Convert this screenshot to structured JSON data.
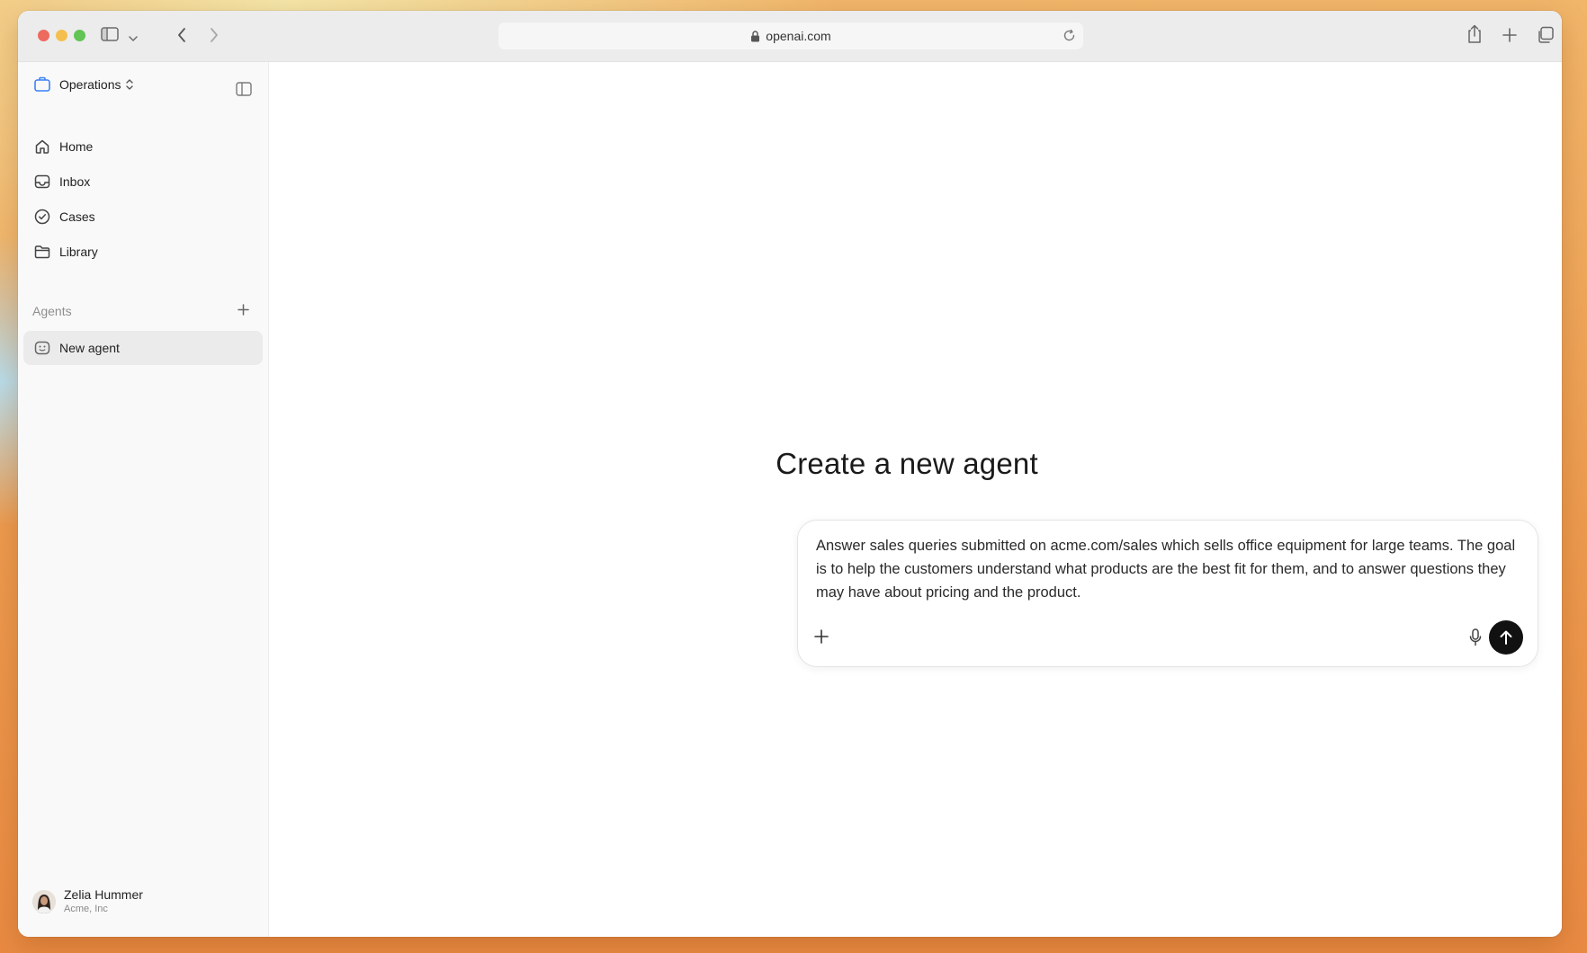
{
  "browser": {
    "url": "openai.com"
  },
  "sidebar": {
    "workspace": "Operations",
    "nav": [
      {
        "label": "Home"
      },
      {
        "label": "Inbox"
      },
      {
        "label": "Cases"
      },
      {
        "label": "Library"
      }
    ],
    "agents_section": "Agents",
    "agents": [
      {
        "label": "New agent"
      }
    ],
    "user": {
      "name": "Zelia Hummer",
      "org": "Acme, Inc"
    }
  },
  "main": {
    "headline": "Create a new agent",
    "composer": {
      "text": "Answer sales queries submitted on acme.com/sales which sells office equipment for large teams. The goal is to help the customers understand what products are the best fit for them, and to answer questions they may have about pricing and the product."
    }
  },
  "colors": {
    "send_button": "#111111",
    "workspace_icon": "#3b82f6",
    "traffic_red": "#ed6a5e",
    "traffic_yellow": "#f5bf4f",
    "traffic_green": "#61c454"
  }
}
